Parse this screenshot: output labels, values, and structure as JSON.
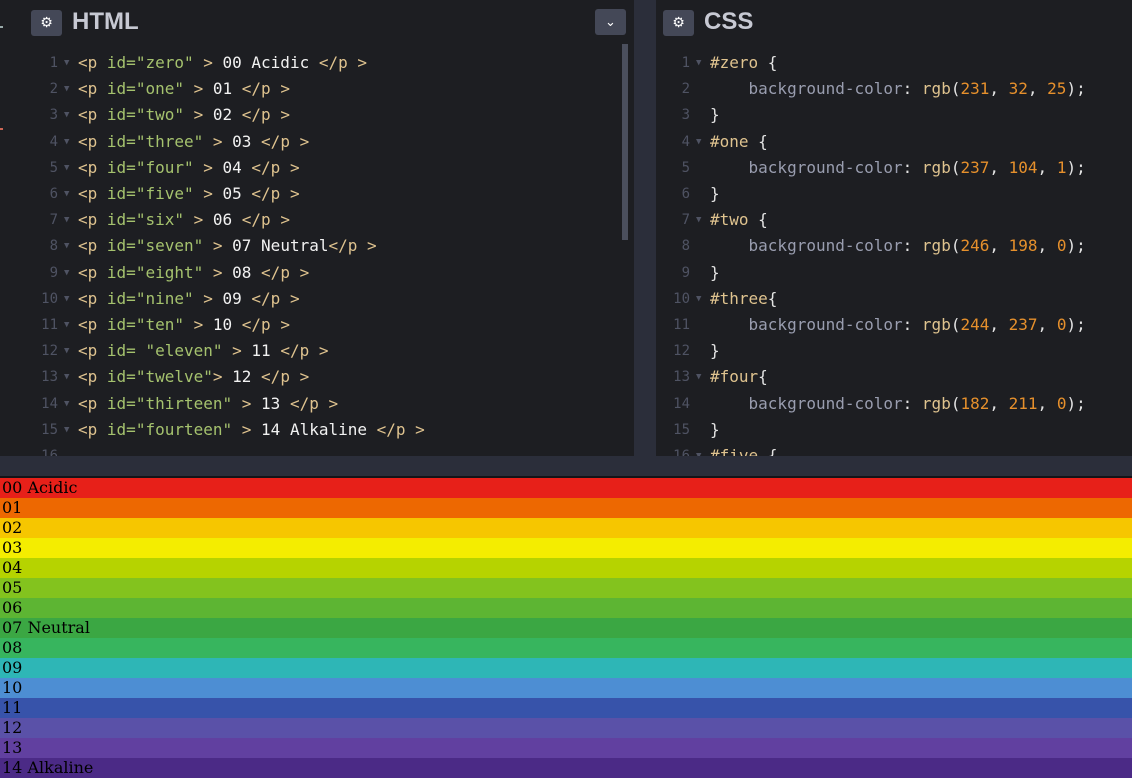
{
  "html_panel": {
    "title": "HTML",
    "settings_icon": "gear-icon",
    "collapse_icon": "chevron-down-icon"
  },
  "css_panel": {
    "title": "CSS",
    "settings_icon": "gear-icon"
  },
  "html_lines": [
    {
      "num": "1",
      "id": "zero",
      "pre": "",
      "post": " ",
      "text": " 00 Acidic "
    },
    {
      "num": "2",
      "id": "one",
      "pre": "",
      "post": " ",
      "text": " 01 "
    },
    {
      "num": "3",
      "id": "two",
      "pre": "",
      "post": " ",
      "text": " 02 "
    },
    {
      "num": "4",
      "id": "three",
      "pre": "",
      "post": " ",
      "text": " 03 "
    },
    {
      "num": "5",
      "id": "four",
      "pre": "",
      "post": " ",
      "text": " 04 "
    },
    {
      "num": "6",
      "id": "five",
      "pre": "",
      "post": " ",
      "text": " 05 "
    },
    {
      "num": "7",
      "id": "six",
      "pre": "",
      "post": " ",
      "text": " 06 "
    },
    {
      "num": "8",
      "id": "seven",
      "pre": "",
      "post": " ",
      "text": " 07 Neutral"
    },
    {
      "num": "9",
      "id": "eight",
      "pre": "",
      "post": " ",
      "text": " 08 "
    },
    {
      "num": "10",
      "id": "nine",
      "pre": "",
      "post": " ",
      "text": " 09 "
    },
    {
      "num": "11",
      "id": "ten",
      "pre": "",
      "post": " ",
      "text": " 10 "
    },
    {
      "num": "12",
      "id": "eleven",
      "pre": " ",
      "post": " ",
      "text": " 11 "
    },
    {
      "num": "13",
      "id": "twelve",
      "pre": "",
      "post": "",
      "text": " 12 "
    },
    {
      "num": "14",
      "id": "thirteen",
      "pre": "",
      "post": " ",
      "text": " 13 "
    },
    {
      "num": "15",
      "id": "fourteen",
      "pre": "",
      "post": " ",
      "text": " 14 Alkaline "
    }
  ],
  "html_next_line_num": "16",
  "css_lines": [
    {
      "num": "1",
      "kind": "sel",
      "sel": "#zero ",
      "fold": true
    },
    {
      "num": "2",
      "kind": "decl",
      "prop": "background-color",
      "r": "231",
      "g": "32",
      "b": "25"
    },
    {
      "num": "3",
      "kind": "close"
    },
    {
      "num": "4",
      "kind": "sel",
      "sel": "#one ",
      "fold": true
    },
    {
      "num": "5",
      "kind": "decl",
      "prop": "background-color",
      "r": "237",
      "g": "104",
      "b": "1"
    },
    {
      "num": "6",
      "kind": "close"
    },
    {
      "num": "7",
      "kind": "sel",
      "sel": "#two ",
      "fold": true
    },
    {
      "num": "8",
      "kind": "decl",
      "prop": "background-color",
      "r": "246",
      "g": "198",
      "b": "0"
    },
    {
      "num": "9",
      "kind": "close"
    },
    {
      "num": "10",
      "kind": "sel",
      "sel": "#three",
      "fold": true
    },
    {
      "num": "11",
      "kind": "decl",
      "prop": "background-color",
      "r": "244",
      "g": "237",
      "b": "0"
    },
    {
      "num": "12",
      "kind": "close"
    },
    {
      "num": "13",
      "kind": "sel",
      "sel": "#four",
      "fold": true
    },
    {
      "num": "14",
      "kind": "decl",
      "prop": "background-color",
      "r": "182",
      "g": "211",
      "b": "0"
    },
    {
      "num": "15",
      "kind": "close"
    },
    {
      "num": "16",
      "kind": "sel",
      "sel": "#five ",
      "fold": true
    }
  ],
  "result_bands": [
    {
      "label": "00 Acidic",
      "color": "#e72019"
    },
    {
      "label": "01",
      "color": "#ed6801"
    },
    {
      "label": "02",
      "color": "#f6c600"
    },
    {
      "label": "03",
      "color": "#f4ed00"
    },
    {
      "label": "04",
      "color": "#b6d300"
    },
    {
      "label": "05",
      "color": "#83c31e"
    },
    {
      "label": "06",
      "color": "#5db533"
    },
    {
      "label": "07 Neutral",
      "color": "#3ba743"
    },
    {
      "label": "08",
      "color": "#37b55e"
    },
    {
      "label": "09",
      "color": "#2eb6b6"
    },
    {
      "label": "10",
      "color": "#4d8ed3"
    },
    {
      "label": "11",
      "color": "#3753aa"
    },
    {
      "label": "12",
      "color": "#5a51a8"
    },
    {
      "label": "13",
      "color": "#6140a0"
    },
    {
      "label": "14 Alkaline",
      "color": "#4b2a86"
    }
  ]
}
